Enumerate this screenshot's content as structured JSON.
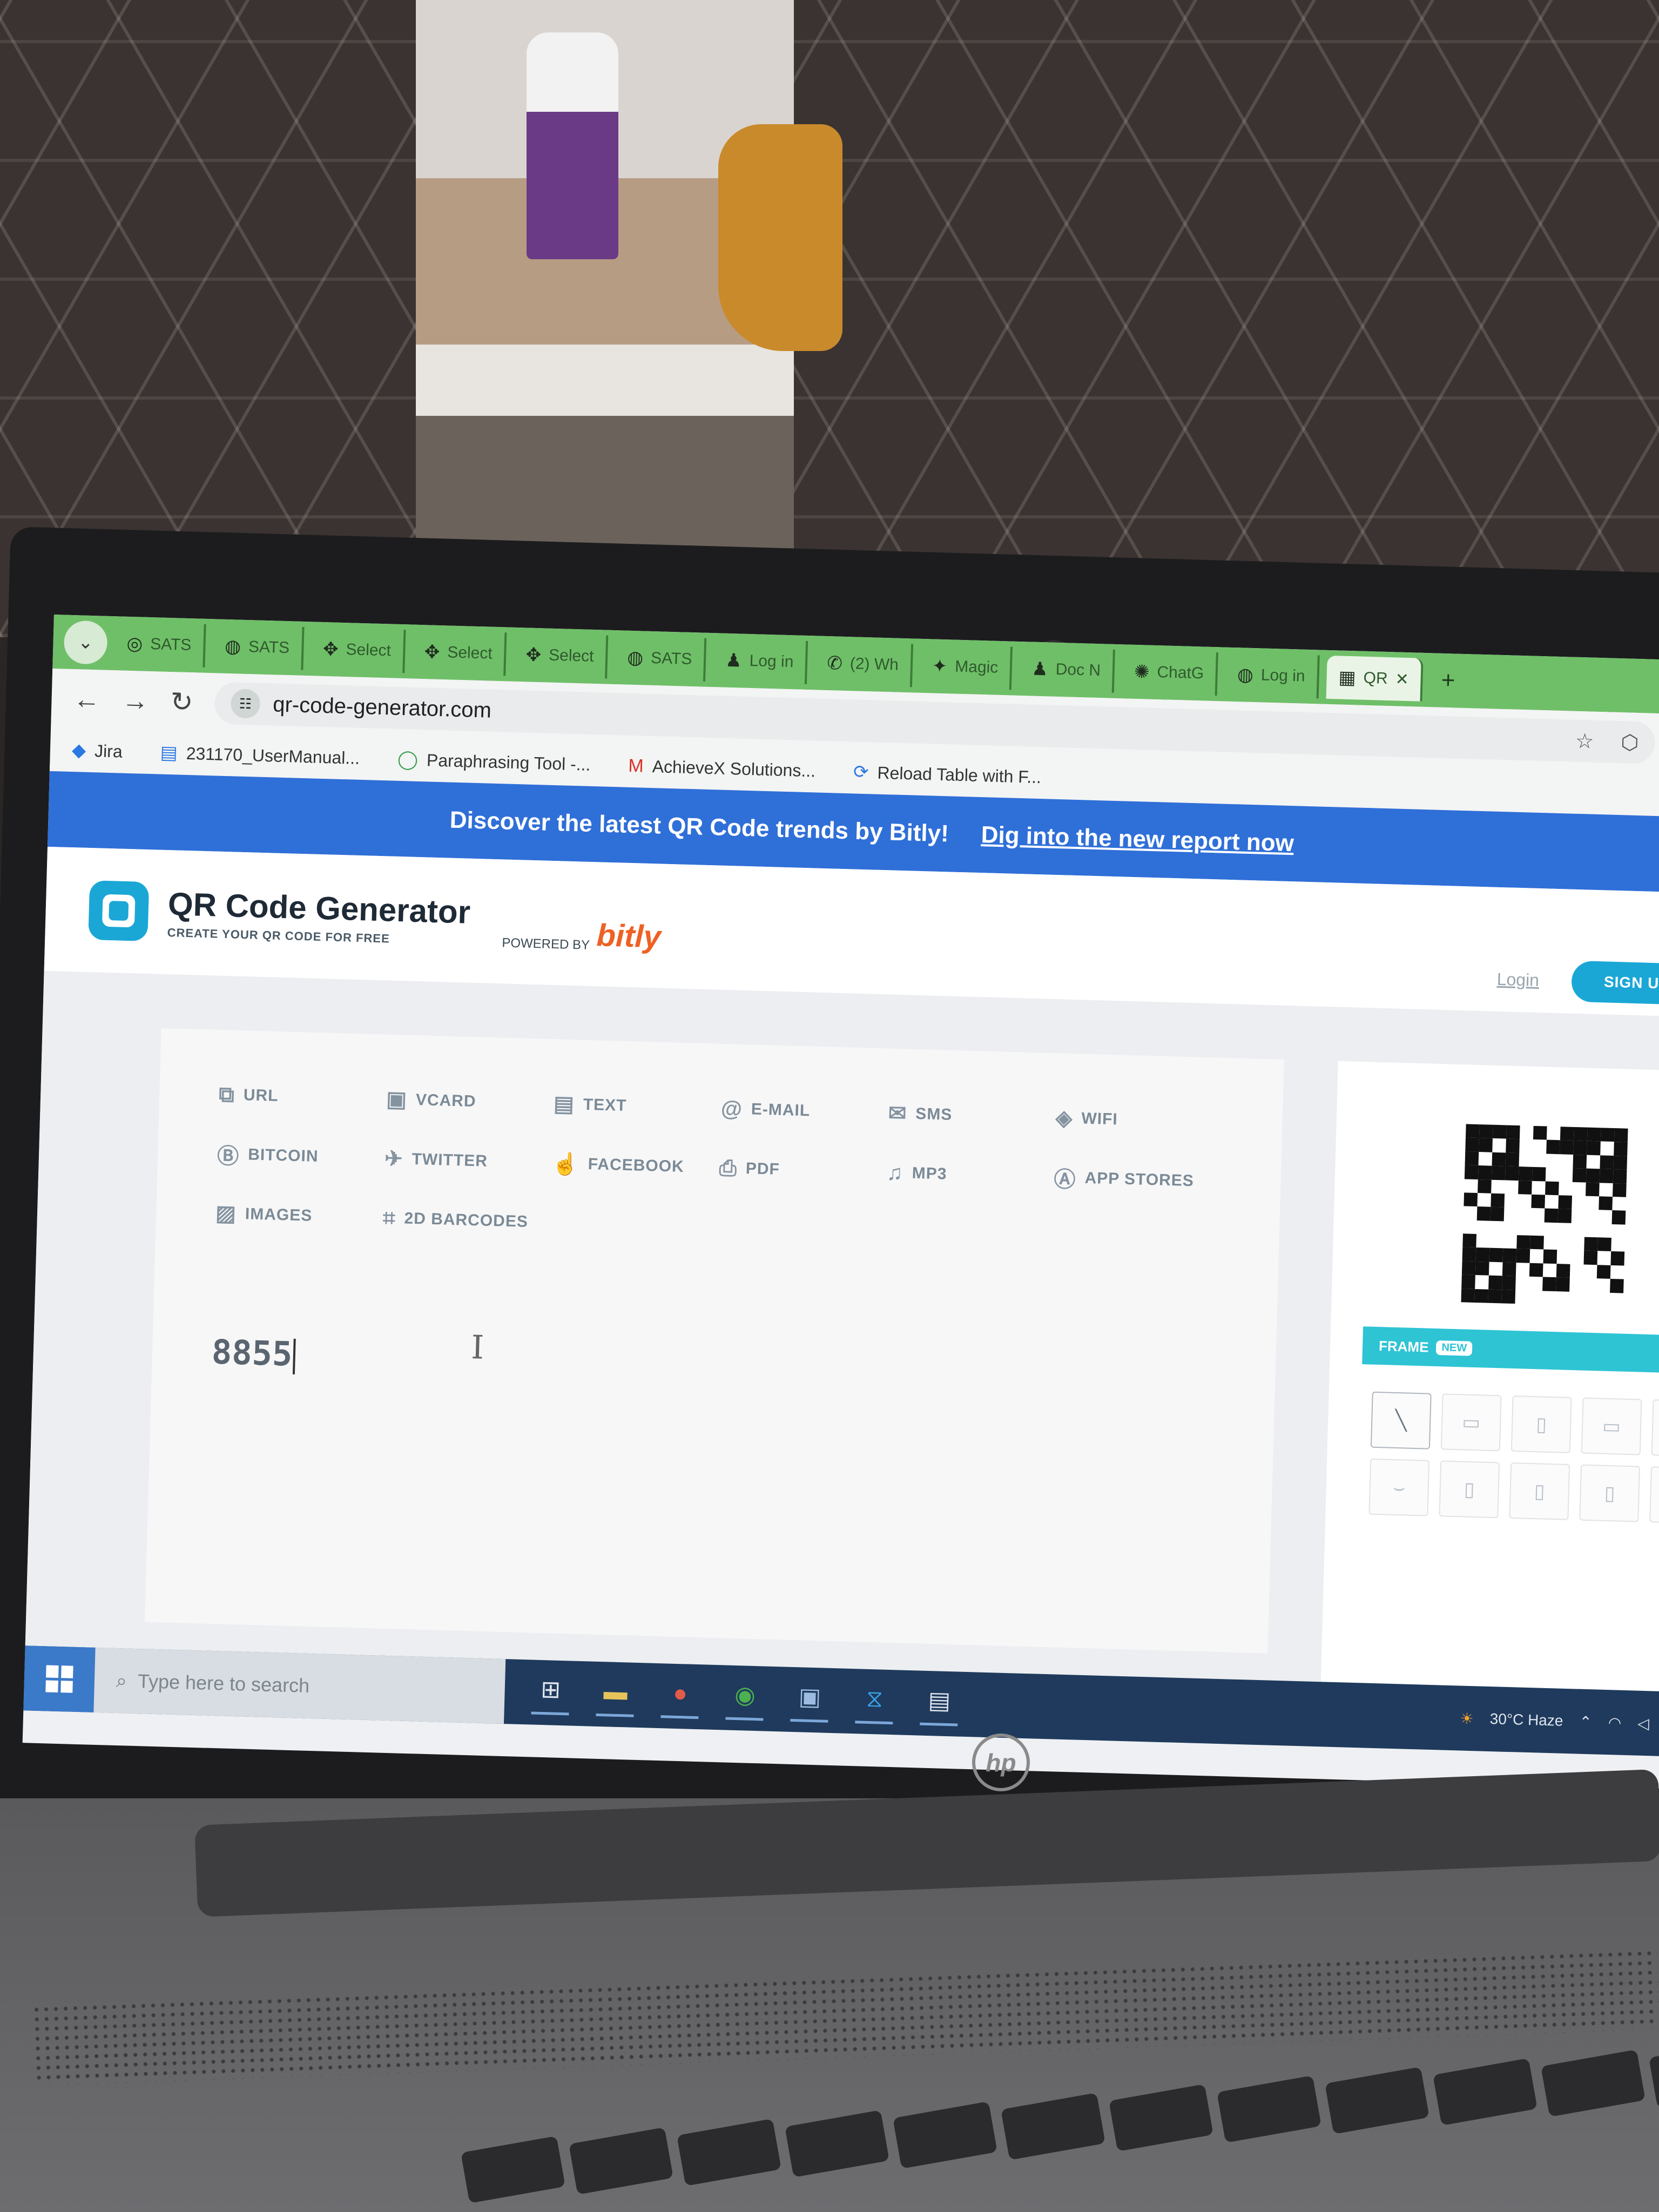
{
  "browser": {
    "tabs": [
      {
        "label": "SATS",
        "icon": "sats-icon"
      },
      {
        "label": "SATS",
        "icon": "globe-icon"
      },
      {
        "label": "Select",
        "icon": "puzzle-icon"
      },
      {
        "label": "Select",
        "icon": "puzzle-icon"
      },
      {
        "label": "Select",
        "icon": "puzzle-icon"
      },
      {
        "label": "SATS",
        "icon": "globe-icon"
      },
      {
        "label": "Log in",
        "icon": "user-icon"
      },
      {
        "label": "(2) Wh",
        "icon": "whatsapp-icon"
      },
      {
        "label": "Magic",
        "icon": "magic-icon"
      },
      {
        "label": "Doc N",
        "icon": "user-icon"
      },
      {
        "label": "ChatG",
        "icon": "chat-icon"
      },
      {
        "label": "Log in",
        "icon": "globe-icon"
      },
      {
        "label": "QR",
        "icon": "qr-icon"
      }
    ],
    "url": "qr-code-generator.com",
    "bookmarks": [
      {
        "label": "Jira",
        "icon": "jira-icon"
      },
      {
        "label": "231170_UserManual...",
        "icon": "doc-icon"
      },
      {
        "label": "Paraphrasing Tool -...",
        "icon": "quillbot-icon"
      },
      {
        "label": "AchieveX Solutions...",
        "icon": "gmail-icon"
      },
      {
        "label": "Reload Table with F...",
        "icon": "reload-icon"
      }
    ]
  },
  "banner": {
    "text": "Discover the latest QR Code trends by Bitly!",
    "link": "Dig into the new report now"
  },
  "header": {
    "title": "QR Code Generator",
    "subtitle": "CREATE YOUR QR CODE FOR FREE",
    "powered_by": "POWERED BY",
    "brand": "bitly",
    "login": "Login",
    "signup": "SIGN UP"
  },
  "qr_types": [
    {
      "label": "URL",
      "icon": "link-icon"
    },
    {
      "label": "VCARD",
      "icon": "contact-card-icon"
    },
    {
      "label": "TEXT",
      "icon": "text-doc-icon"
    },
    {
      "label": "E-MAIL",
      "icon": "at-icon"
    },
    {
      "label": "SMS",
      "icon": "sms-icon"
    },
    {
      "label": "WIFI",
      "icon": "wifi-icon"
    },
    {
      "label": "BITCOIN",
      "icon": "bitcoin-icon"
    },
    {
      "label": "TWITTER",
      "icon": "bird-icon"
    },
    {
      "label": "FACEBOOK",
      "icon": "thumbs-up-icon"
    },
    {
      "label": "PDF",
      "icon": "pdf-icon"
    },
    {
      "label": "MP3",
      "icon": "music-note-icon"
    },
    {
      "label": "APP STORES",
      "icon": "app-store-icon"
    },
    {
      "label": "IMAGES",
      "icon": "image-icon"
    },
    {
      "label": "2D BARCODES",
      "icon": "barcode-icon"
    }
  ],
  "input_value": "8855",
  "frame": {
    "label": "FRAME",
    "badge": "NEW"
  },
  "taskbar": {
    "search_placeholder": "Type here to search",
    "tray_weather": "30°C Haze"
  },
  "laptop_brand": "hp"
}
